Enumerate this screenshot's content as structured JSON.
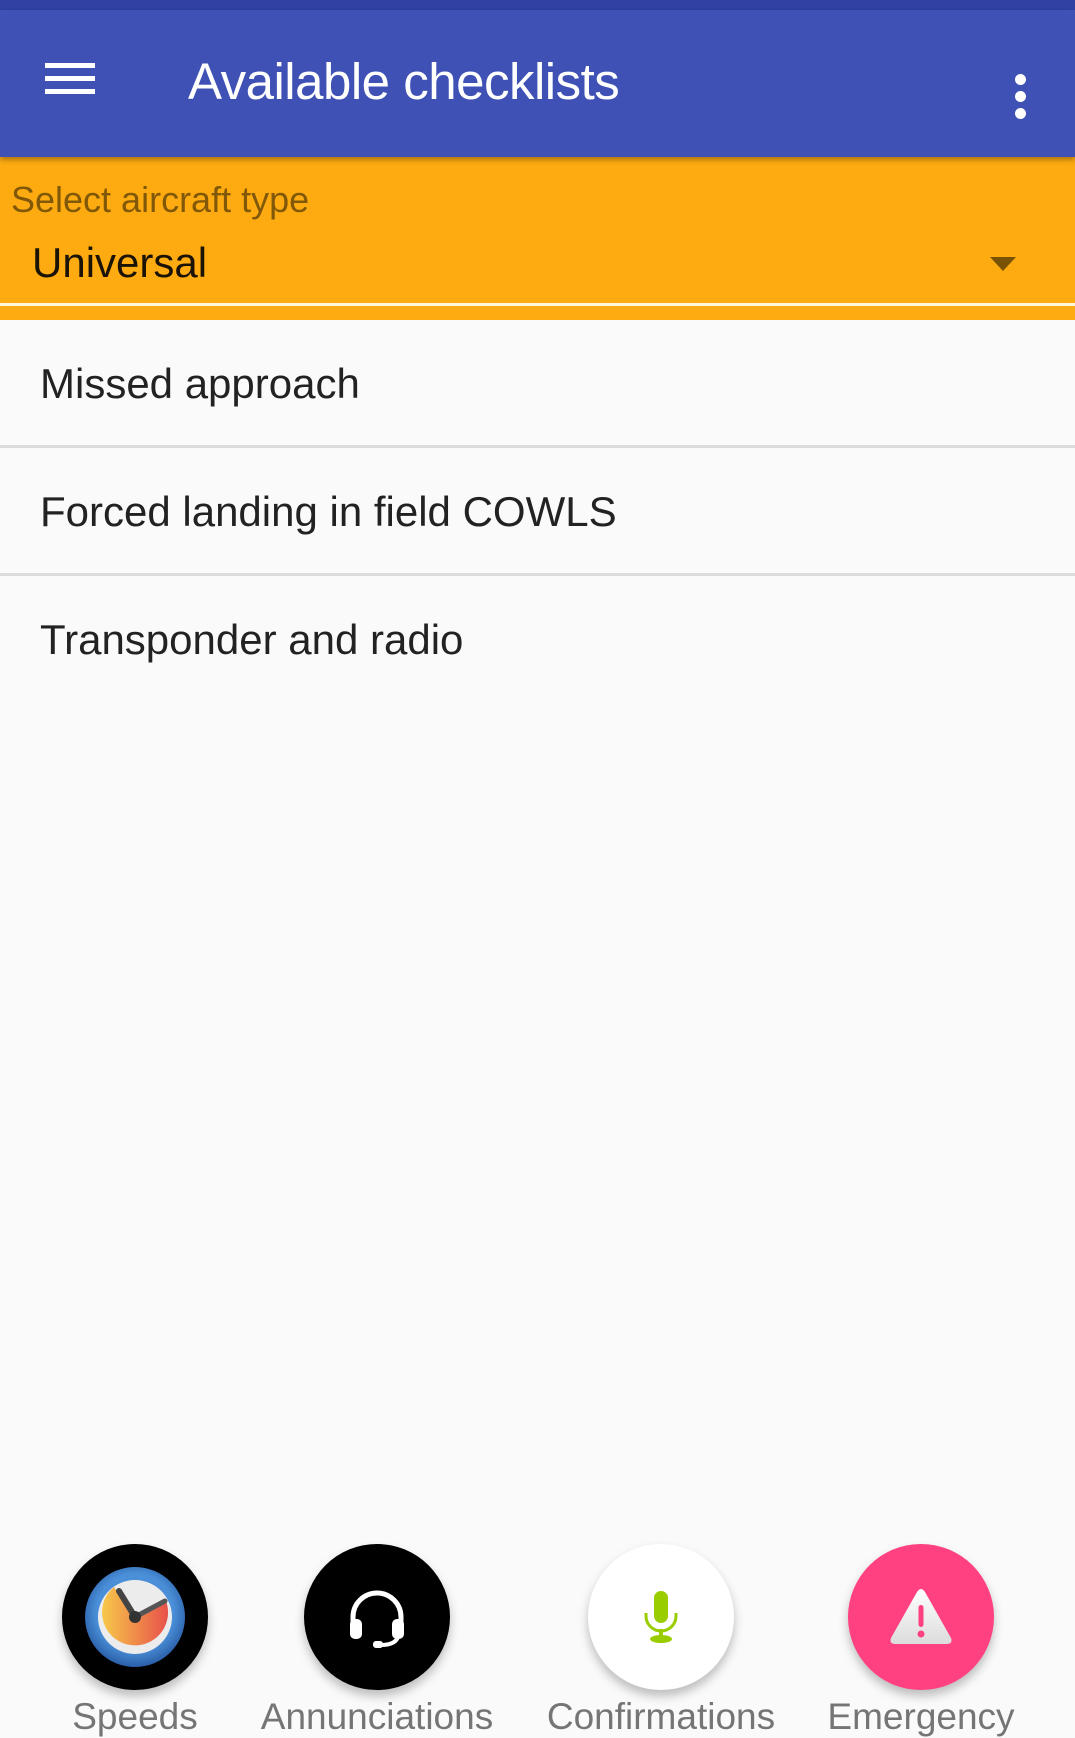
{
  "toolbar": {
    "title": "Available checklists",
    "menu_icon": "hamburger-menu-icon",
    "overflow_icon": "more-vert-icon",
    "color": "#3F51B5"
  },
  "aircraft_selector": {
    "label": "Select aircraft type",
    "selected_value": "Universal",
    "dropdown_icon": "dropdown-arrow-icon",
    "color": "#FDAB11"
  },
  "checklists": [
    {
      "label": "Missed approach"
    },
    {
      "label": "Forced landing in field COWLS"
    },
    {
      "label": "Transponder and radio"
    }
  ],
  "fab_bar": [
    {
      "label": "Speeds",
      "icon": "clock-icon",
      "background": "#000000"
    },
    {
      "label": "Annunciations",
      "icon": "headset-icon",
      "background": "#000000"
    },
    {
      "label": "Confirmations",
      "icon": "microphone-icon",
      "background": "#FFFFFF"
    },
    {
      "label": "Emergency",
      "icon": "warning-icon",
      "background": "#FF4081"
    }
  ]
}
